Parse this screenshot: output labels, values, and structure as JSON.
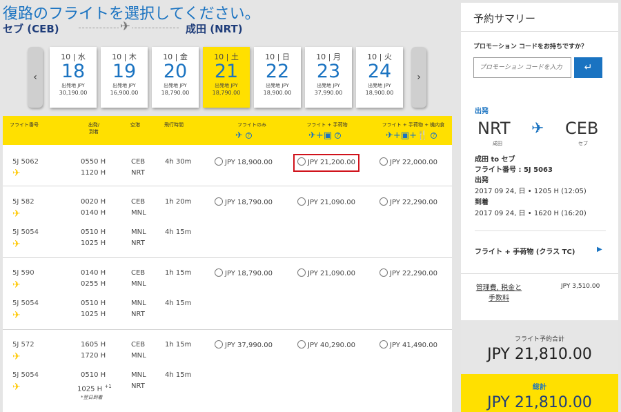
{
  "header": {
    "title": "復路のフライトを選択してください。",
    "from": "セブ (CEB)",
    "to": "成田 (NRT)"
  },
  "dates": [
    {
      "dow": "10 | 水",
      "day": "18",
      "from_label": "出発地 JPY",
      "price": "30,190.00"
    },
    {
      "dow": "10 | 木",
      "day": "19",
      "from_label": "出発地 JPY",
      "price": "16,900.00"
    },
    {
      "dow": "10 | 金",
      "day": "20",
      "from_label": "出発地 JPY",
      "price": "18,790.00"
    },
    {
      "dow": "10 | 土",
      "day": "21",
      "from_label": "出発地 JPY",
      "price": "18,790.00",
      "selected": true
    },
    {
      "dow": "10 | 日",
      "day": "22",
      "from_label": "出発地 JPY",
      "price": "18,900.00"
    },
    {
      "dow": "10 | 月",
      "day": "23",
      "from_label": "出発地 JPY",
      "price": "37,990.00"
    },
    {
      "dow": "10 | 火",
      "day": "24",
      "from_label": "出発地 JPY",
      "price": "18,900.00"
    }
  ],
  "table": {
    "headers": {
      "flight_no": "フライト番号",
      "dep_arr_1": "出発/",
      "dep_arr_2": "到着",
      "airport": "空港",
      "duration": "飛行時間",
      "fare1": "フライトのみ",
      "fare2": "フライト + 手荷物",
      "fare3": "フライト + 手荷物 + 機内食"
    },
    "groups": [
      {
        "legs": [
          {
            "flight": "5J 5062",
            "dep": "0550 H",
            "arr": "1120 H",
            "from": "CEB",
            "to": "NRT",
            "duration": "4h 30m"
          }
        ],
        "fares": [
          "JPY 18,900.00",
          "JPY 21,200.00",
          "JPY 22,000.00"
        ]
      },
      {
        "legs": [
          {
            "flight": "5J 582",
            "dep": "0020 H",
            "arr": "0140 H",
            "from": "CEB",
            "to": "MNL",
            "duration": "1h 20m"
          },
          {
            "flight": "5J 5054",
            "dep": "0510 H",
            "arr": "1025 H",
            "from": "MNL",
            "to": "NRT",
            "duration": "4h 15m"
          }
        ],
        "fares": [
          "JPY 18,790.00",
          "JPY 21,090.00",
          "JPY 22,290.00"
        ]
      },
      {
        "legs": [
          {
            "flight": "5J 590",
            "dep": "0140 H",
            "arr": "0255 H",
            "from": "CEB",
            "to": "MNL",
            "duration": "1h 15m"
          },
          {
            "flight": "5J 5054",
            "dep": "0510 H",
            "arr": "1025 H",
            "from": "MNL",
            "to": "NRT",
            "duration": "4h 15m"
          }
        ],
        "fares": [
          "JPY 18,790.00",
          "JPY 21,090.00",
          "JPY 22,290.00"
        ]
      },
      {
        "legs": [
          {
            "flight": "5J 572",
            "dep": "1605 H",
            "arr": "1720 H",
            "from": "CEB",
            "to": "MNL",
            "duration": "1h 15m"
          },
          {
            "flight": "5J 5054",
            "dep": "0510 H",
            "arr": "1025 H",
            "from": "MNL",
            "to": "NRT",
            "duration": "4h 15m",
            "arr_sup": "+1",
            "note": "*翌日到着"
          }
        ],
        "fares": [
          "JPY 37,990.00",
          "JPY 40,290.00",
          "JPY 41,490.00"
        ]
      }
    ]
  },
  "summary": {
    "title": "予約サマリー",
    "promo_question": "プロモーション コードをお持ちですか？",
    "promo_placeholder": "プロモーション コードを入力",
    "promo_button": "↵",
    "departure_label": "出発",
    "origin_code": "NRT",
    "origin_city": "成田",
    "dest_code": "CEB",
    "dest_city": "セブ",
    "route": "成田 to セブ",
    "flight_number": "フライト番号 : 5J 5063",
    "dep_heading": "出発",
    "dep_time": "2017 09 24, 日 • 1205 H (12:05)",
    "arr_heading": "到着",
    "arr_time": "2017 09 24, 日 • 1620 H (16:20)",
    "fare_class": "フライト + 手荷物 (クラス TC)",
    "fees_label": "管理費, 税金と手数料",
    "fees_amount": "JPY 3,510.00",
    "subtotal_label": "フライト予約合計",
    "subtotal_amount": "JPY 21,810.00",
    "total_label": "総計",
    "total_amount": "JPY 21,810.00"
  },
  "colors": {
    "accent": "#1a73c1",
    "highlight": "#ffe000",
    "selection_box": "#d0121b"
  }
}
